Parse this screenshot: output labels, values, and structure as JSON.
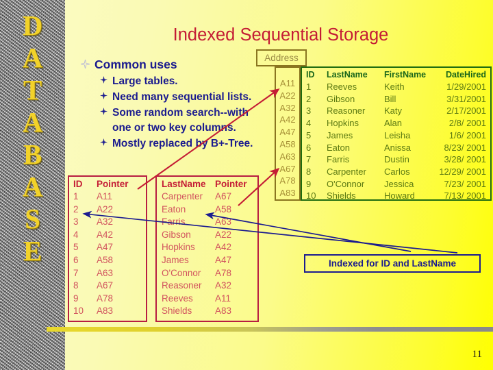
{
  "sidebar": {
    "word": "DATABASE",
    "letters": [
      "D",
      "A",
      "T",
      "A",
      "B",
      "A",
      "S",
      "E"
    ],
    "text_color": "#f2d22a"
  },
  "slide": {
    "title": "Indexed Sequential Storage",
    "title_color": "#c41c35",
    "page_number": "11",
    "background_colors": {
      "left": "#fcfcc8",
      "right": "#ffff00"
    }
  },
  "bullets": {
    "top": "Common uses",
    "items": [
      {
        "text": "Large tables.",
        "continuation": ""
      },
      {
        "text": "Need many sequential lists.",
        "continuation": ""
      },
      {
        "text": "Some random search--with",
        "continuation": "one or two key columns."
      },
      {
        "text": "Mostly replaced by B+-Tree.",
        "continuation": ""
      }
    ],
    "text_color": "#1b1b8f"
  },
  "address_column": {
    "label": "Address",
    "border_color": "#8a7520",
    "text_color": "#a79137",
    "values": [
      "A11",
      "A22",
      "A32",
      "A42",
      "A47",
      "A58",
      "A63",
      "A67",
      "A78",
      "A83"
    ]
  },
  "employee_table": {
    "border_color": "#1f6b10",
    "header_color": "#19661a",
    "body_color": "#5c7a12",
    "columns": [
      "ID",
      "LastName",
      "FirstName",
      "DateHired"
    ],
    "rows": [
      [
        "1",
        "Reeves",
        "Keith",
        "1/29/2001"
      ],
      [
        "2",
        "Gibson",
        "Bill",
        "3/31/2001"
      ],
      [
        "3",
        "Reasoner",
        "Katy",
        "2/17/2001"
      ],
      [
        "4",
        "Hopkins",
        "Alan",
        "2/8/ 2001"
      ],
      [
        "5",
        "James",
        "Leisha",
        "1/6/ 2001"
      ],
      [
        "6",
        "Eaton",
        "Anissa",
        "8/23/ 2001"
      ],
      [
        "7",
        "Farris",
        "Dustin",
        "3/28/ 2001"
      ],
      [
        "8",
        "Carpenter",
        "Carlos",
        "12/29/ 2001"
      ],
      [
        "9",
        "O'Connor",
        "Jessica",
        "7/23/ 2001"
      ],
      [
        "10",
        "Shields",
        "Howard",
        "7/13/ 2001"
      ]
    ]
  },
  "index_id_table": {
    "border_color": "#b81d42",
    "header_color": "#c41c35",
    "body_color": "#d1535e",
    "columns": [
      "ID",
      "Pointer"
    ],
    "rows": [
      [
        "1",
        "A11"
      ],
      [
        "2",
        "A22"
      ],
      [
        "3",
        "A32"
      ],
      [
        "4",
        "A42"
      ],
      [
        "5",
        "A47"
      ],
      [
        "6",
        "A58"
      ],
      [
        "7",
        "A63"
      ],
      [
        "8",
        "A67"
      ],
      [
        "9",
        "A78"
      ],
      [
        "10",
        "A83"
      ]
    ]
  },
  "index_lastname_table": {
    "border_color": "#b81d42",
    "header_color": "#c41c35",
    "body_color": "#d1535e",
    "columns": [
      "LastName",
      "Pointer"
    ],
    "rows": [
      [
        "Carpenter",
        "A67"
      ],
      [
        "Eaton",
        "A58"
      ],
      [
        "Farris",
        "A63"
      ],
      [
        "Gibson",
        "A22"
      ],
      [
        "Hopkins",
        "A42"
      ],
      [
        "James",
        "A47"
      ],
      [
        "O'Connor",
        "A78"
      ],
      [
        "Reasoner",
        "A32"
      ],
      [
        "Reeves",
        "A11"
      ],
      [
        "Shields",
        "A83"
      ]
    ]
  },
  "callout": {
    "text": "Indexed for ID and LastName",
    "color": "#1b1b8f"
  },
  "arrows": {
    "pointer_arrow_color": "#c41c35",
    "index_arrow_color": "#1b1b8f"
  }
}
